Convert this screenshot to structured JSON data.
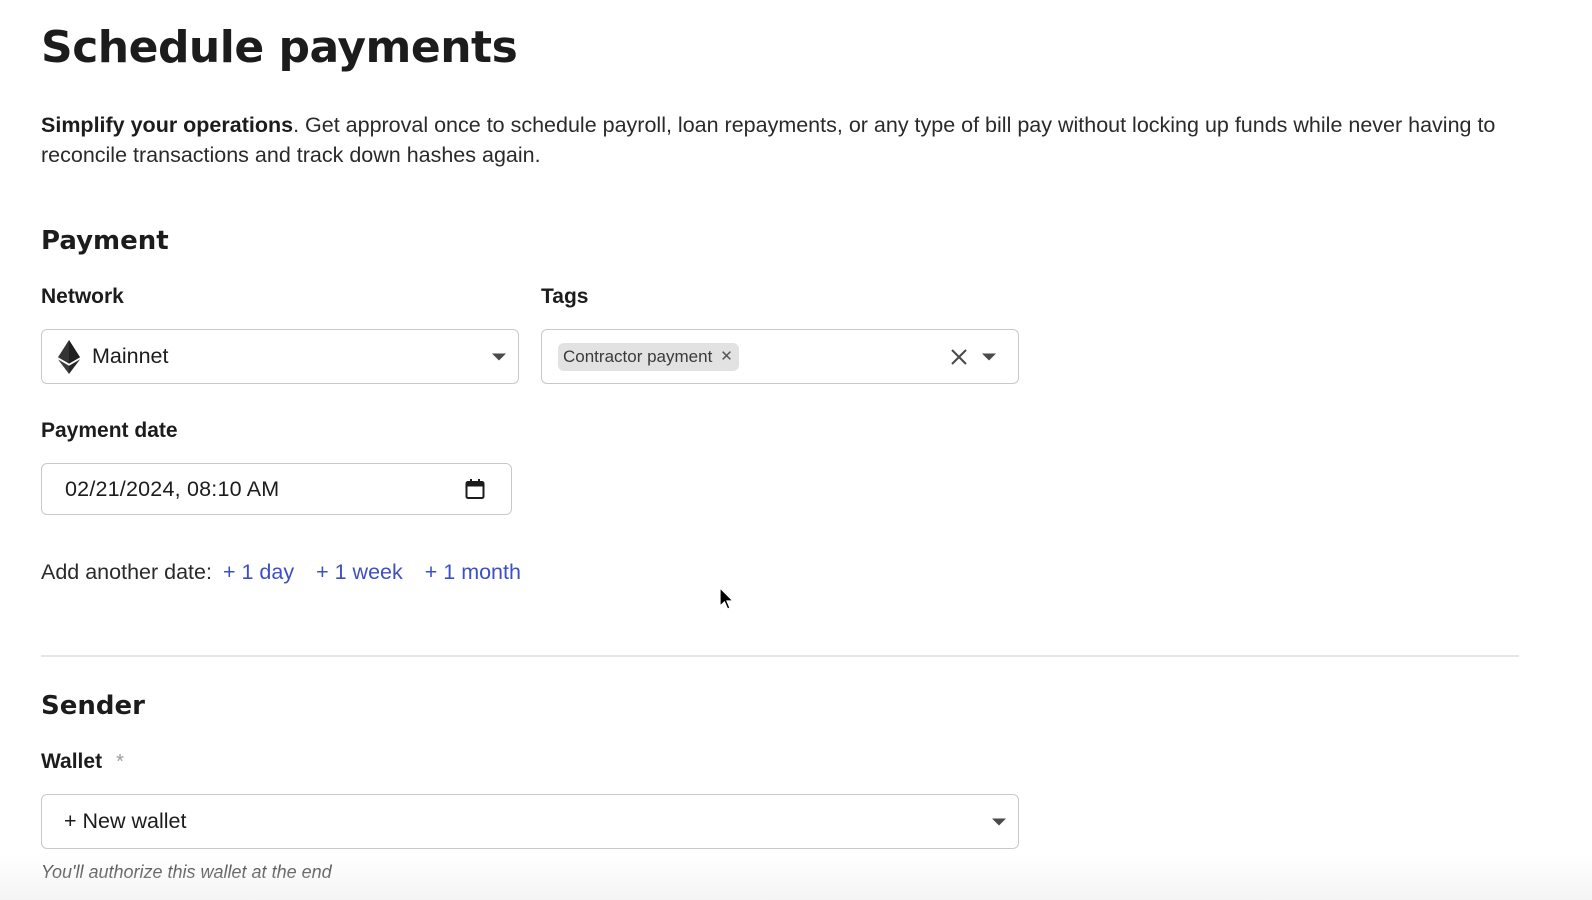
{
  "page": {
    "title": "Schedule payments",
    "intro_bold": "Simplify your operations",
    "intro_rest": ". Get approval once to schedule payroll, loan repayments, or any type of bill pay without locking up funds while never having to reconcile transactions and track down hashes again."
  },
  "payment": {
    "heading": "Payment",
    "network": {
      "label": "Network",
      "value": "Mainnet",
      "icon": "ethereum-icon"
    },
    "tags": {
      "label": "Tags",
      "selected": [
        "Contractor payment"
      ]
    },
    "payment_date": {
      "label": "Payment date",
      "value": "02/21/2024, 08:10 AM"
    },
    "add_another_date": {
      "label": "Add another date:",
      "options": [
        "+ 1 day",
        "+ 1 week",
        "+ 1 month"
      ]
    }
  },
  "sender": {
    "heading": "Sender",
    "wallet": {
      "label": "Wallet",
      "required_mark": "*",
      "value": "+ New wallet",
      "hint": "You'll authorize this wallet at the end"
    }
  },
  "colors": {
    "link": "#3d4fc4",
    "border": "#c9c9c9",
    "chip_bg": "#e2e2e2",
    "divider": "#e6e6e6"
  }
}
